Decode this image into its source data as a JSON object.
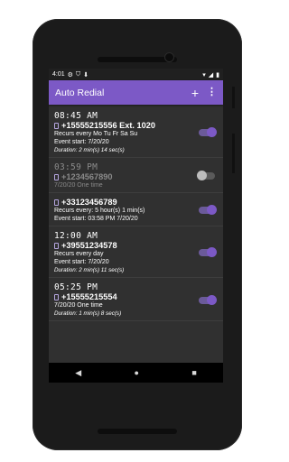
{
  "status": {
    "time": "4:01",
    "icons": [
      "gear-icon",
      "shield-icon",
      "arrow-down-icon",
      "wifi-icon",
      "signal-icon",
      "battery-icon"
    ]
  },
  "appbar": {
    "title": "Auto Redial",
    "add_label": "+",
    "more_label": "⋮"
  },
  "items": [
    {
      "time": "08:45 AM",
      "number": "+15555215556 Ext. 1020",
      "line1": "Recurs every  Mo Tu Fr Sa Su",
      "line2": "Event start:  7/20/20",
      "duration": "Duration: 2 min(s) 14 sec(s)",
      "enabled": true
    },
    {
      "time": "03:59 PM",
      "number": "+1234567890",
      "line1": "7/20/20  One time",
      "enabled": false
    },
    {
      "time": "",
      "number": "+33123456789",
      "line1": "Recurs every: 5 hour(s) 1 min(s)",
      "line2": "Event start:  03:58 PM 7/20/20",
      "enabled": true
    },
    {
      "time": "12:00 AM",
      "number": "+39551234578",
      "line1": "Recurs every day",
      "line2": "Event start:  7/20/20",
      "duration": "Duration: 2 min(s) 11 sec(s)",
      "enabled": true
    },
    {
      "time": "05:25 PM",
      "number": "+15555215554",
      "line1": "7/20/20  One time",
      "duration": "Duration: 1 min(s) 8 sec(s)",
      "enabled": true
    }
  ],
  "nav": {
    "back": "◀",
    "home": "●",
    "recents": "■"
  },
  "colors": {
    "accent": "#7c59c6",
    "background": "#303030"
  }
}
